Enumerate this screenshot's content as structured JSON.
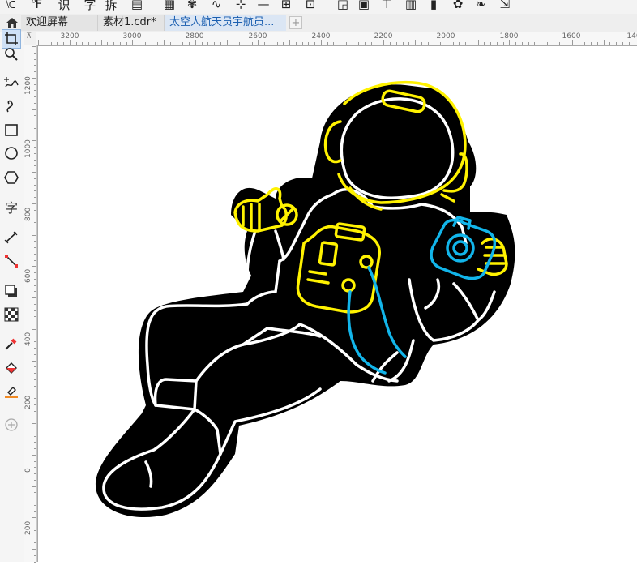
{
  "toolbar": {
    "items": [
      {
        "name": "pick-dropdown-icon",
        "glyph": "⟈"
      },
      {
        "name": "script-icon",
        "glyph": "℉"
      },
      {
        "name": "identify-tool-label",
        "label": "识"
      },
      {
        "name": "char-tool-label",
        "label": "字"
      },
      {
        "name": "split-tool-label",
        "label": "拆"
      },
      {
        "name": "page-icon",
        "glyph": "▤"
      },
      {
        "name": "grid-icon",
        "glyph": "▦"
      },
      {
        "name": "pattern-icon",
        "glyph": "✾"
      },
      {
        "name": "wave-icon",
        "glyph": "∿"
      },
      {
        "name": "node-icon",
        "glyph": "⊹"
      },
      {
        "name": "line-icon",
        "glyph": "—"
      },
      {
        "name": "align-icon",
        "glyph": "⊞"
      },
      {
        "name": "snap-icon",
        "glyph": "⊡"
      },
      {
        "name": "object-icon",
        "glyph": "◲"
      },
      {
        "name": "image-icon",
        "glyph": "▣"
      },
      {
        "name": "text-frame-icon",
        "glyph": "⊤"
      },
      {
        "name": "table-icon",
        "glyph": "▥"
      },
      {
        "name": "barcode-icon",
        "glyph": "▮"
      },
      {
        "name": "plugin-icon",
        "glyph": "✿"
      },
      {
        "name": "leaf-icon",
        "glyph": "❧"
      },
      {
        "name": "export-icon",
        "glyph": "⇲"
      }
    ]
  },
  "tabs": {
    "home_label": "欢迎屏幕",
    "doc1_label": "素材1.cdr*",
    "active_label": "太空人航天员宇航员...",
    "add_glyph": "+"
  },
  "rulers": {
    "horizontal": [
      "3200",
      "3000",
      "2800",
      "2600",
      "2400",
      "2200",
      "2000",
      "1800",
      "1600",
      "140"
    ],
    "vertical": [
      "1200",
      "1000",
      "800",
      "600",
      "400",
      "200",
      "0",
      "200"
    ],
    "corner_glyph": "⊼"
  },
  "colors": {
    "accent_blue": "#1b5fb0",
    "neon_yellow": "#fff200",
    "neon_cyan": "#12b5ea",
    "ink": "#000000"
  }
}
